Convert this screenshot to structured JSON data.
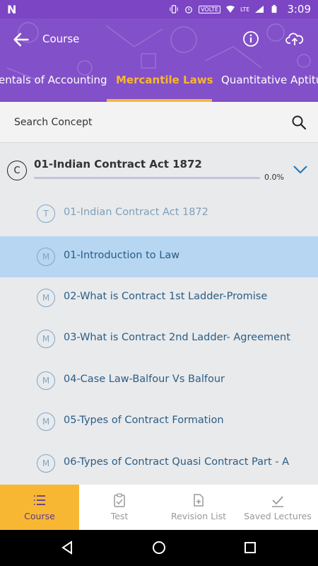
{
  "status_bar": {
    "time": "3:09",
    "volte": "VOLTE",
    "network": "LTE",
    "battery": "R"
  },
  "header": {
    "title": "Course",
    "tabs": [
      {
        "label": "entals of Accounting"
      },
      {
        "label": "Mercantile Laws",
        "selected": true
      },
      {
        "label": "Quantitative Aptitude"
      }
    ]
  },
  "search": {
    "placeholder": "Search Concept"
  },
  "chapter": {
    "badge": "C",
    "title": "01-Indian Contract Act 1872",
    "progress": "0.0%",
    "progress_value": 0
  },
  "items": [
    {
      "badge": "T",
      "label": "01-Indian Contract Act 1872"
    },
    {
      "badge": "M",
      "label": "01-Introduction to Law",
      "active": true
    },
    {
      "badge": "M",
      "label": "02-What is Contract 1st Ladder-Promise"
    },
    {
      "badge": "M",
      "label": "03-What is Contract 2nd Ladder- Agreement"
    },
    {
      "badge": "M",
      "label": "04-Case Law-Balfour Vs Balfour"
    },
    {
      "badge": "M",
      "label": "05-Types of Contract Formation"
    },
    {
      "badge": "M",
      "label": "06-Types of Contract Quasi Contract Part - A"
    }
  ],
  "bottom_nav": [
    {
      "label": "Course",
      "icon": "list-icon",
      "active": true
    },
    {
      "label": "Test",
      "icon": "clipboard-check-icon"
    },
    {
      "label": "Revision List",
      "icon": "file-add-icon"
    },
    {
      "label": "Saved Lectures",
      "icon": "checkmark-icon"
    }
  ],
  "colors": {
    "header": "#8250c8",
    "accent": "#f7b733",
    "active_row": "#b6d6f2",
    "link_text": "#2a5d85"
  }
}
